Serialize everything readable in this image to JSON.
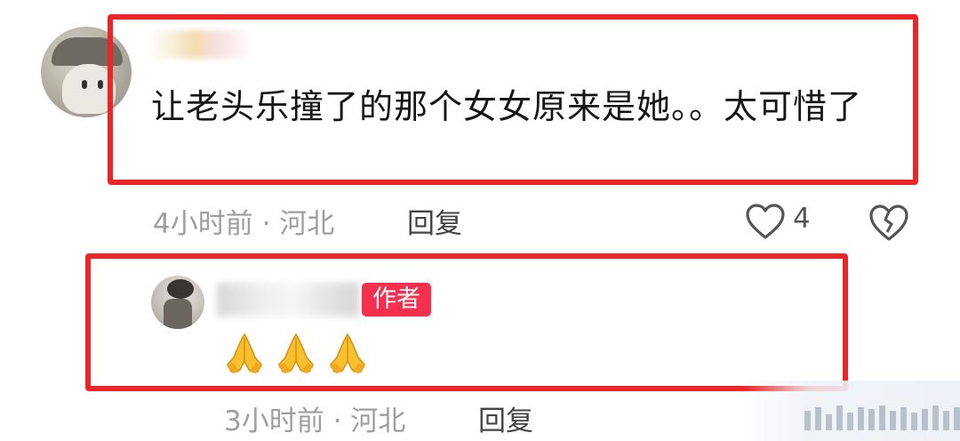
{
  "comment": {
    "text": "让老头乐撞了的那个女女原来是她。。太可惜了",
    "meta": "4小时前 · 河北",
    "reply_label": "回复",
    "like_count": "4"
  },
  "reply": {
    "author_badge": "作者",
    "text": "🙏🙏🙏",
    "meta": "3小时前 · 河北",
    "reply_label": "回复"
  },
  "colors": {
    "highlight_box": "#ee2426",
    "author_badge": "#f5304e",
    "meta_text": "#9e9e9e"
  },
  "icons": [
    "heart-outline-icon",
    "broken-heart-icon",
    "folded-hands-emoji"
  ]
}
